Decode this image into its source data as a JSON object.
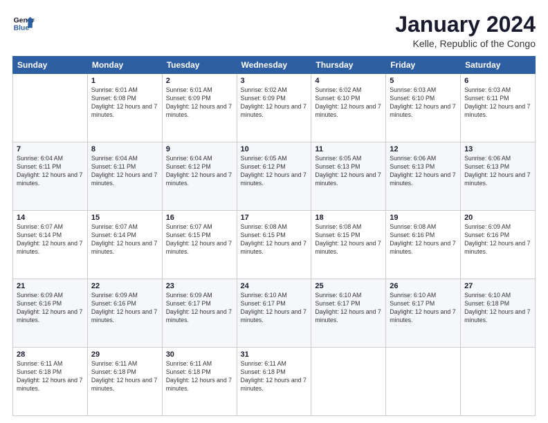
{
  "logo": {
    "line1": "General",
    "line2": "Blue"
  },
  "title": "January 2024",
  "subtitle": "Kelle, Republic of the Congo",
  "days_of_week": [
    "Sunday",
    "Monday",
    "Tuesday",
    "Wednesday",
    "Thursday",
    "Friday",
    "Saturday"
  ],
  "weeks": [
    [
      {
        "day": "",
        "sunrise": "",
        "sunset": "",
        "daylight": ""
      },
      {
        "day": "1",
        "sunrise": "Sunrise: 6:01 AM",
        "sunset": "Sunset: 6:08 PM",
        "daylight": "Daylight: 12 hours and 7 minutes."
      },
      {
        "day": "2",
        "sunrise": "Sunrise: 6:01 AM",
        "sunset": "Sunset: 6:09 PM",
        "daylight": "Daylight: 12 hours and 7 minutes."
      },
      {
        "day": "3",
        "sunrise": "Sunrise: 6:02 AM",
        "sunset": "Sunset: 6:09 PM",
        "daylight": "Daylight: 12 hours and 7 minutes."
      },
      {
        "day": "4",
        "sunrise": "Sunrise: 6:02 AM",
        "sunset": "Sunset: 6:10 PM",
        "daylight": "Daylight: 12 hours and 7 minutes."
      },
      {
        "day": "5",
        "sunrise": "Sunrise: 6:03 AM",
        "sunset": "Sunset: 6:10 PM",
        "daylight": "Daylight: 12 hours and 7 minutes."
      },
      {
        "day": "6",
        "sunrise": "Sunrise: 6:03 AM",
        "sunset": "Sunset: 6:11 PM",
        "daylight": "Daylight: 12 hours and 7 minutes."
      }
    ],
    [
      {
        "day": "7",
        "sunrise": "Sunrise: 6:04 AM",
        "sunset": "Sunset: 6:11 PM",
        "daylight": "Daylight: 12 hours and 7 minutes."
      },
      {
        "day": "8",
        "sunrise": "Sunrise: 6:04 AM",
        "sunset": "Sunset: 6:11 PM",
        "daylight": "Daylight: 12 hours and 7 minutes."
      },
      {
        "day": "9",
        "sunrise": "Sunrise: 6:04 AM",
        "sunset": "Sunset: 6:12 PM",
        "daylight": "Daylight: 12 hours and 7 minutes."
      },
      {
        "day": "10",
        "sunrise": "Sunrise: 6:05 AM",
        "sunset": "Sunset: 6:12 PM",
        "daylight": "Daylight: 12 hours and 7 minutes."
      },
      {
        "day": "11",
        "sunrise": "Sunrise: 6:05 AM",
        "sunset": "Sunset: 6:13 PM",
        "daylight": "Daylight: 12 hours and 7 minutes."
      },
      {
        "day": "12",
        "sunrise": "Sunrise: 6:06 AM",
        "sunset": "Sunset: 6:13 PM",
        "daylight": "Daylight: 12 hours and 7 minutes."
      },
      {
        "day": "13",
        "sunrise": "Sunrise: 6:06 AM",
        "sunset": "Sunset: 6:13 PM",
        "daylight": "Daylight: 12 hours and 7 minutes."
      }
    ],
    [
      {
        "day": "14",
        "sunrise": "Sunrise: 6:07 AM",
        "sunset": "Sunset: 6:14 PM",
        "daylight": "Daylight: 12 hours and 7 minutes."
      },
      {
        "day": "15",
        "sunrise": "Sunrise: 6:07 AM",
        "sunset": "Sunset: 6:14 PM",
        "daylight": "Daylight: 12 hours and 7 minutes."
      },
      {
        "day": "16",
        "sunrise": "Sunrise: 6:07 AM",
        "sunset": "Sunset: 6:15 PM",
        "daylight": "Daylight: 12 hours and 7 minutes."
      },
      {
        "day": "17",
        "sunrise": "Sunrise: 6:08 AM",
        "sunset": "Sunset: 6:15 PM",
        "daylight": "Daylight: 12 hours and 7 minutes."
      },
      {
        "day": "18",
        "sunrise": "Sunrise: 6:08 AM",
        "sunset": "Sunset: 6:15 PM",
        "daylight": "Daylight: 12 hours and 7 minutes."
      },
      {
        "day": "19",
        "sunrise": "Sunrise: 6:08 AM",
        "sunset": "Sunset: 6:16 PM",
        "daylight": "Daylight: 12 hours and 7 minutes."
      },
      {
        "day": "20",
        "sunrise": "Sunrise: 6:09 AM",
        "sunset": "Sunset: 6:16 PM",
        "daylight": "Daylight: 12 hours and 7 minutes."
      }
    ],
    [
      {
        "day": "21",
        "sunrise": "Sunrise: 6:09 AM",
        "sunset": "Sunset: 6:16 PM",
        "daylight": "Daylight: 12 hours and 7 minutes."
      },
      {
        "day": "22",
        "sunrise": "Sunrise: 6:09 AM",
        "sunset": "Sunset: 6:16 PM",
        "daylight": "Daylight: 12 hours and 7 minutes."
      },
      {
        "day": "23",
        "sunrise": "Sunrise: 6:09 AM",
        "sunset": "Sunset: 6:17 PM",
        "daylight": "Daylight: 12 hours and 7 minutes."
      },
      {
        "day": "24",
        "sunrise": "Sunrise: 6:10 AM",
        "sunset": "Sunset: 6:17 PM",
        "daylight": "Daylight: 12 hours and 7 minutes."
      },
      {
        "day": "25",
        "sunrise": "Sunrise: 6:10 AM",
        "sunset": "Sunset: 6:17 PM",
        "daylight": "Daylight: 12 hours and 7 minutes."
      },
      {
        "day": "26",
        "sunrise": "Sunrise: 6:10 AM",
        "sunset": "Sunset: 6:17 PM",
        "daylight": "Daylight: 12 hours and 7 minutes."
      },
      {
        "day": "27",
        "sunrise": "Sunrise: 6:10 AM",
        "sunset": "Sunset: 6:18 PM",
        "daylight": "Daylight: 12 hours and 7 minutes."
      }
    ],
    [
      {
        "day": "28",
        "sunrise": "Sunrise: 6:11 AM",
        "sunset": "Sunset: 6:18 PM",
        "daylight": "Daylight: 12 hours and 7 minutes."
      },
      {
        "day": "29",
        "sunrise": "Sunrise: 6:11 AM",
        "sunset": "Sunset: 6:18 PM",
        "daylight": "Daylight: 12 hours and 7 minutes."
      },
      {
        "day": "30",
        "sunrise": "Sunrise: 6:11 AM",
        "sunset": "Sunset: 6:18 PM",
        "daylight": "Daylight: 12 hours and 7 minutes."
      },
      {
        "day": "31",
        "sunrise": "Sunrise: 6:11 AM",
        "sunset": "Sunset: 6:18 PM",
        "daylight": "Daylight: 12 hours and 7 minutes."
      },
      {
        "day": "",
        "sunrise": "",
        "sunset": "",
        "daylight": ""
      },
      {
        "day": "",
        "sunrise": "",
        "sunset": "",
        "daylight": ""
      },
      {
        "day": "",
        "sunrise": "",
        "sunset": "",
        "daylight": ""
      }
    ]
  ]
}
